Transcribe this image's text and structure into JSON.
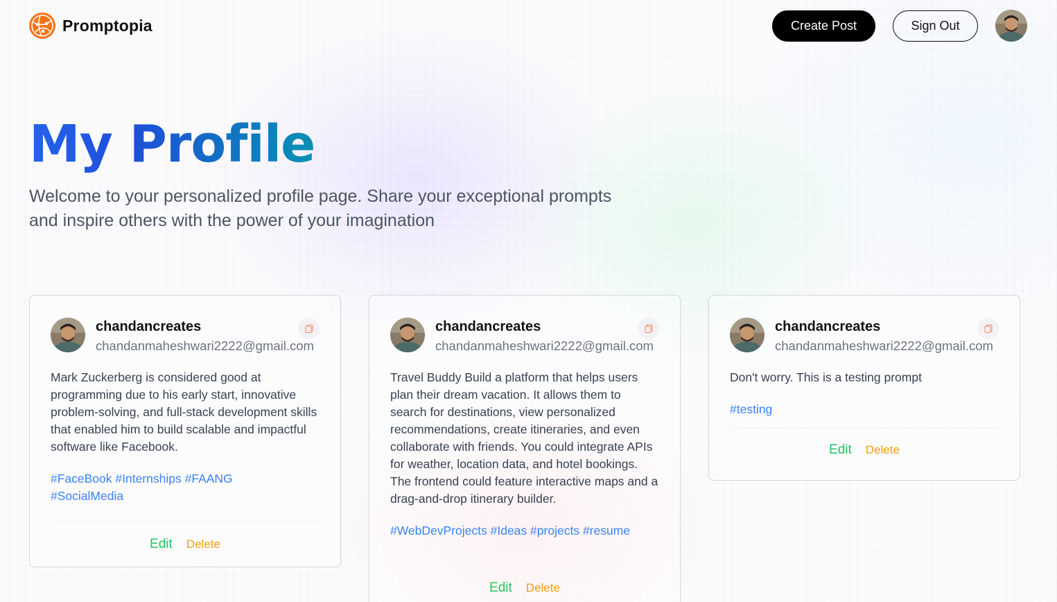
{
  "nav": {
    "brand": "Promptopia",
    "create_post": "Create Post",
    "sign_out": "Sign Out"
  },
  "header": {
    "title": "My Profile",
    "description": "Welcome to your personalized profile page. Share your exceptional prompts and inspire others with the power of your imagination"
  },
  "colors": {
    "title_gradient_start": "#2563eb",
    "title_gradient_end": "#0891b2",
    "tag": "#3b82f6",
    "edit": "#22c55e",
    "delete": "#f59e0b",
    "brand": "#f97316"
  },
  "cards": [
    {
      "username": "chandancreates",
      "email": "chandanmaheshwari2222@gmail.com",
      "prompt": "Mark Zuckerberg is considered good at programming due to his early start, innovative problem-solving, and full-stack development skills that enabled him to build scalable and impactful software like Facebook.",
      "tags": [
        "#FaceBook",
        "#Internships",
        "#FAANG",
        "#SocialMedia"
      ],
      "edit": "Edit",
      "delete": "Delete"
    },
    {
      "username": "chandancreates",
      "email": "chandanmaheshwari2222@gmail.com",
      "prompt": "Travel Buddy Build a platform that helps users plan their dream vacation. It allows them to search for destinations, view personalized recommendations, create itineraries, and even collaborate with friends. You could integrate APIs for weather, location data, and hotel bookings. The frontend could feature interactive maps and a drag-and-drop itinerary builder.",
      "tags": [
        "#WebDevProjects",
        "#Ideas",
        "#projects",
        "#resume"
      ],
      "edit": "Edit",
      "delete": "Delete"
    },
    {
      "username": "chandancreates",
      "email": "chandanmaheshwari2222@gmail.com",
      "prompt": "Don't worry. This is a testing prompt",
      "tags": [
        "#testing"
      ],
      "edit": "Edit",
      "delete": "Delete"
    }
  ]
}
